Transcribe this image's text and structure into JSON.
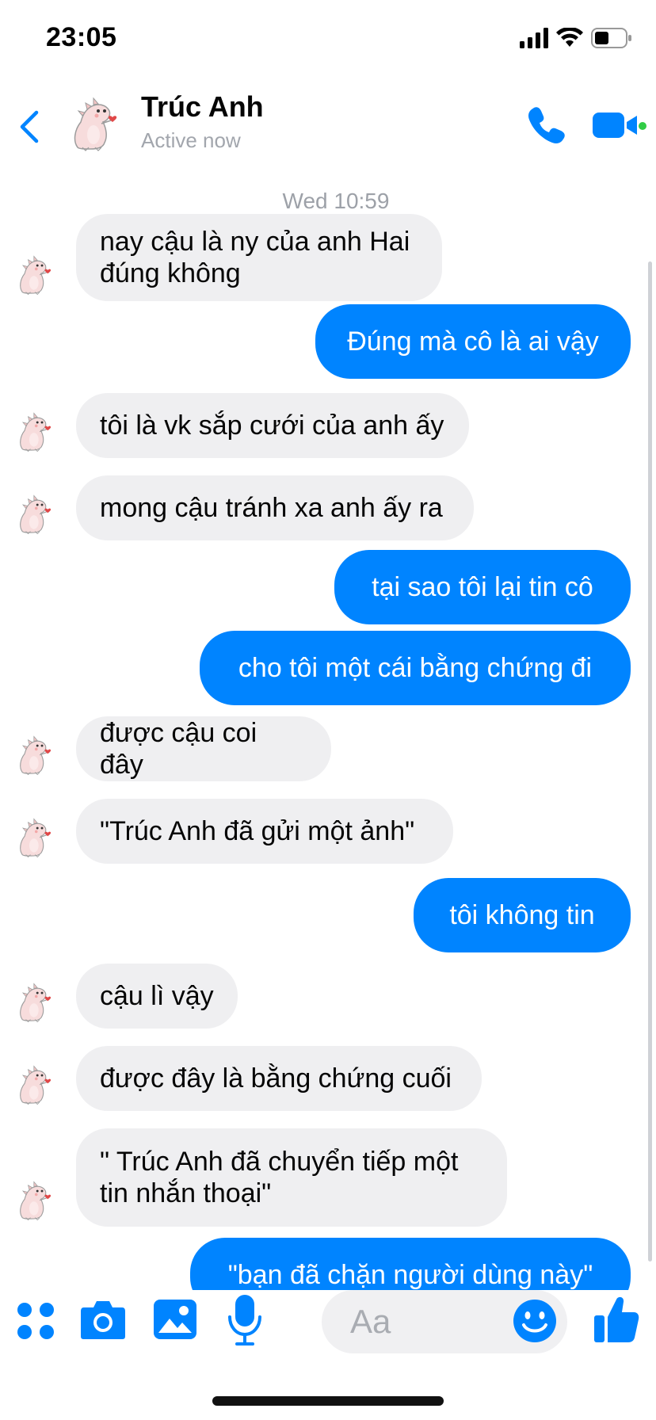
{
  "status_bar": {
    "time": "23:05"
  },
  "header": {
    "back_icon": "chevron-left-icon",
    "contact_name": "Trúc Anh",
    "contact_status": "Active now",
    "call_icon": "phone-icon",
    "video_icon": "video-camera-icon",
    "accent_color": "#0084ff",
    "online_color": "#31cc46"
  },
  "conversation": {
    "timestamp": "Wed 10:59",
    "messages": [
      {
        "direction": "incoming",
        "text": "nay cậu là ny của anh Hai\nđúng không"
      },
      {
        "direction": "outgoing",
        "text": "Đúng mà cô là ai vậy"
      },
      {
        "direction": "incoming",
        "text": "tôi là vk sắp cưới của anh ấy"
      },
      {
        "direction": "incoming",
        "text": "mong cậu tránh xa anh ấy ra"
      },
      {
        "direction": "outgoing",
        "text": "tại sao tôi lại tin cô"
      },
      {
        "direction": "outgoing",
        "text": "cho tôi một cái bằng chứng đi"
      },
      {
        "direction": "incoming",
        "text": "được cậu coi đây"
      },
      {
        "direction": "incoming",
        "text": "\"Trúc Anh đã gửi một ảnh\""
      },
      {
        "direction": "outgoing",
        "text": "tôi không tin"
      },
      {
        "direction": "incoming",
        "text": "cậu lì vậy"
      },
      {
        "direction": "incoming",
        "text": "được đây là bằng chứng cuối"
      },
      {
        "direction": "incoming",
        "text": "\" Trúc Anh đã chuyển tiếp một\ntin nhắn thoại\""
      },
      {
        "direction": "outgoing",
        "text": "\"bạn đã chặn người dùng này\""
      }
    ],
    "incoming_bubble_color": "#efeff1",
    "outgoing_bubble_color": "#0084ff"
  },
  "composer": {
    "tools": [
      "apps-grid-icon",
      "camera-icon",
      "image-icon",
      "microphone-icon"
    ],
    "placeholder": "Aa",
    "emoji_icon": "smiley-icon",
    "like_icon": "thumbs-up-icon"
  }
}
